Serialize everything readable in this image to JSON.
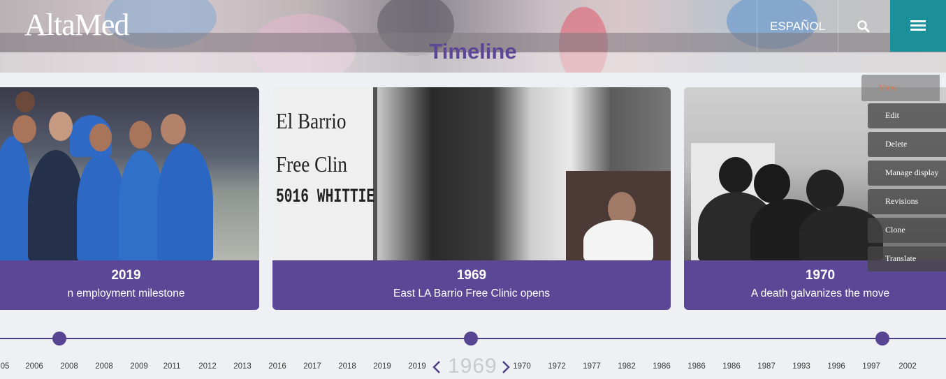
{
  "header": {
    "logo": "AltaMed",
    "language_link": "ESPAÑOL",
    "search_icon": "search-icon",
    "menu_icon": "hamburger-menu-icon",
    "accent_color": "#1b8f9a"
  },
  "page": {
    "title": "Timeline",
    "brand_color": "#5b4796"
  },
  "cards": [
    {
      "year": "2019",
      "title": "n employment milestone"
    },
    {
      "year": "1969",
      "title": "East LA Barrio Free Clinic opens"
    },
    {
      "year": "1970",
      "title": "A death galvanizes the move"
    }
  ],
  "admin_tabs": [
    "View",
    "Edit",
    "Delete",
    "Manage display",
    "Revisions",
    "Clone",
    "Translate"
  ],
  "timeline": {
    "current_year": "1969",
    "prev_icon": "chevron-left-icon",
    "next_icon": "chevron-right-icon",
    "years_left": [
      "05",
      "2006",
      "2008",
      "2008",
      "2009",
      "2011",
      "2012",
      "2013",
      "2016",
      "2017",
      "2018",
      "2019",
      "2019"
    ],
    "years_right": [
      "1970",
      "1972",
      "1977",
      "1982",
      "1986",
      "1986",
      "1986",
      "1987",
      "1993",
      "1996",
      "1997",
      "2002"
    ]
  }
}
